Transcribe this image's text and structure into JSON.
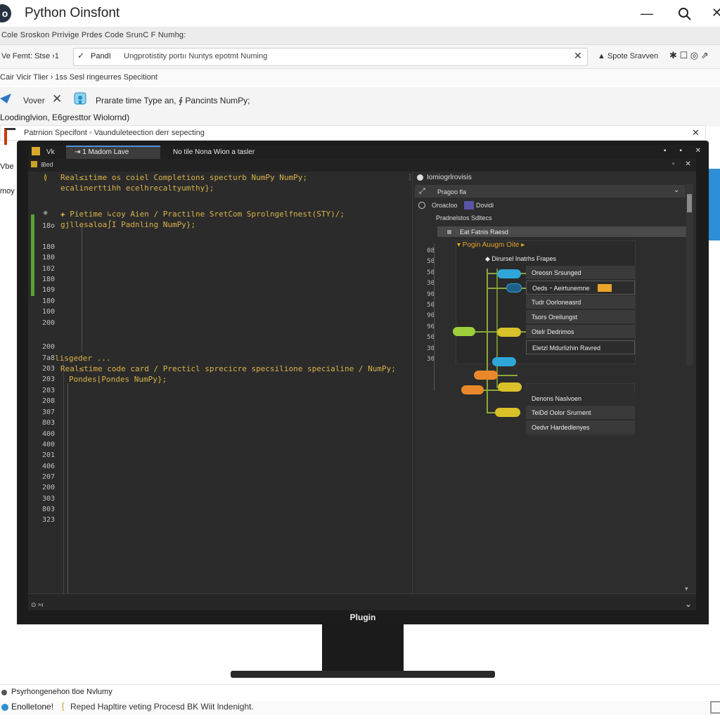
{
  "app": {
    "title": "Python Oinsfont",
    "logo_glyph": "o",
    "minimize_glyph": "—",
    "close_glyph": "✕"
  },
  "menubar": {
    "text": "Cole Sroskon Prrivige Prdes Code SrunC F Numhg:"
  },
  "address": {
    "left_label": "Ve Femt: Stse  ›1",
    "check": "✓",
    "prefix": "PandI",
    "text": "Ungprotistity portıı Nuntys epotmt Numing",
    "clear": "✕",
    "right_label": "▲   Spote Sravven",
    "icons": "✱ ☐  ◎  ⇗"
  },
  "breadcrumb": {
    "text": "Cair Vicir  Tlier  ›  1ss  Sesl ringeurres Specitiont"
  },
  "toolbar": {
    "vote_label": "Vover",
    "x_glyph": "✕",
    "text": "Prarate time Type an, ∮ Pancints NumPy;",
    "subtext": "Loodinglvion, E6gresttor Wiolornd)"
  },
  "notice": {
    "text": "Patrnion Specifont  ◦  Vaunduleteection derr sepecting",
    "close": "✕"
  },
  "side_labels": {
    "vbe": "Vbe",
    "moy": "moy"
  },
  "ide": {
    "vk": "Vk",
    "tab_label": "⇥ 1    Madom Lave",
    "title2": "No tile Nona  Wion a tasler",
    "win_buttons": "▪ ▪ ✕",
    "sub_label": "⊞ed",
    "sub_buttons": "▫ ✕",
    "line_numbers": [
      "18o",
      "180",
      "180",
      "102",
      "180",
      "109",
      "180",
      "100",
      "200",
      "200",
      "7a8",
      "203",
      "203",
      "203",
      "208",
      "307",
      "803",
      "400",
      "400",
      "201",
      "406",
      "207",
      "200",
      "303",
      "803",
      "323"
    ],
    "code_lines": [
      {
        "text": "Real≤ıtime os coiel Completions specturb NumPy NumPy;",
        "color": "#d8b24a"
      },
      {
        "text": "ecalinerttihh ecelhrecaltyumthy};",
        "color": "#d8b24a"
      },
      {
        "text": "✚ Pietime ↳coy Aien ∕ Practilne SretCom Sprolngelfnest(STY)/;",
        "color": "#d8b24a"
      },
      {
        "text": "gjllesaloa∫I Padnling NumPy};",
        "color": "#d8b24a"
      },
      {
        "text": "lisgeder ...",
        "color": "#d8b24a"
      },
      {
        "text": "Real≤time code card ∕ Precticl sprecicre specsilione specialine ∕ NumPy;",
        "color": "#d8b24a"
      },
      {
        "text": "Pondes⌊Pondes NumPy};",
        "color": "#d8b24a"
      }
    ],
    "marks": {
      "m1": "≬",
      "m2": "●"
    },
    "vdots": "⋮",
    "status_left": "⊙ ≈ı",
    "status_right": "⌄",
    "scroll_down": "▾"
  },
  "panel": {
    "title": "Iomiogrlrovisis",
    "search_text": "Pragoo fla",
    "search_icon": "⤢",
    "search_drop": "⌄",
    "row1_text": "Oroacloo",
    "row1_text2": "Dovidi",
    "row2": "Pradnelstos Sdltecs",
    "row3": "Eat Fatnis Raesd",
    "nums": "08\n50\n50\n30\n90\n50\n90\n96\n50\n30\n30",
    "popup_title": "▾  Pogin  Auugm  Oite  ▸",
    "popup_sub": "◆  Dirursel Inatrhs Frapes",
    "menu_items": [
      "Oreosn Srsunged",
      "Oeds ⁃ Aeirtunemne",
      "Tudr Oorloneasrd",
      "Tsors Oreilungst",
      "Otelr Dedrimos",
      "Eletzl Mdurlizhin Ravred"
    ],
    "menu2_items": [
      "Denons Naslvoen",
      "TeiDd Oolor Srurnent",
      "Oedvr Hardedlenyes"
    ]
  },
  "monitor": {
    "brand": "Plugin"
  },
  "status": {
    "line1": "Psyrhongenehon tloe Nvlumy",
    "line2_label": "Enolletone!",
    "bracket": "[",
    "line2_rest": "Reped Hapltire veting Procesd BK Wiit lndenight."
  },
  "colors": {
    "accent_blue": "#2e8ed8",
    "code_yellow": "#d8b24a",
    "brand_orange": "#e8a52a",
    "gutter_green": "#5aa133"
  }
}
